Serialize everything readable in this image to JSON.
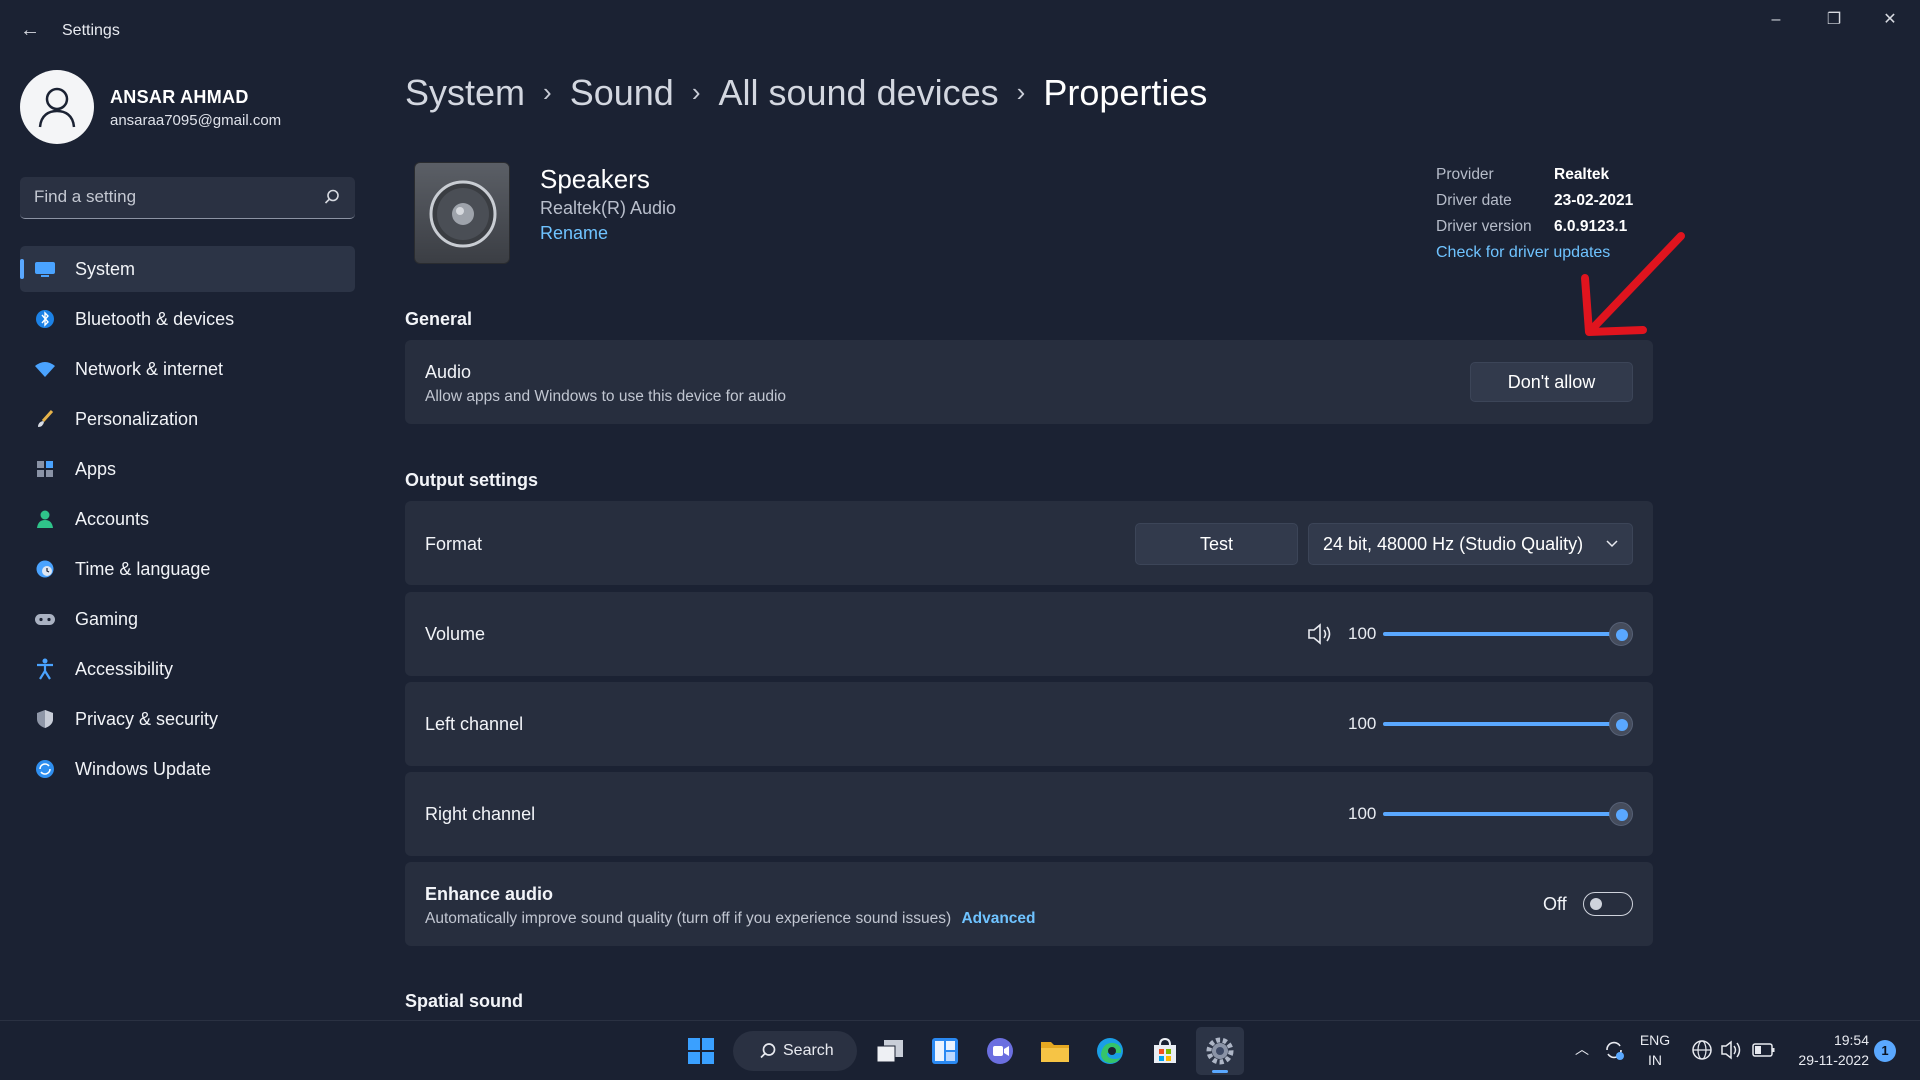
{
  "window": {
    "title": "Settings",
    "controls": [
      "minimize",
      "restore",
      "close"
    ]
  },
  "profile": {
    "name": "ANSAR AHMAD",
    "email": "ansaraa7095@gmail.com"
  },
  "search": {
    "placeholder": "Find a setting"
  },
  "sidebar": {
    "items": [
      {
        "label": "System",
        "icon": "monitor-icon",
        "active": true
      },
      {
        "label": "Bluetooth & devices",
        "icon": "bluetooth-icon"
      },
      {
        "label": "Network & internet",
        "icon": "wifi-icon"
      },
      {
        "label": "Personalization",
        "icon": "brush-icon"
      },
      {
        "label": "Apps",
        "icon": "apps-icon"
      },
      {
        "label": "Accounts",
        "icon": "person-icon"
      },
      {
        "label": "Time & language",
        "icon": "globe-clock-icon"
      },
      {
        "label": "Gaming",
        "icon": "gamepad-icon"
      },
      {
        "label": "Accessibility",
        "icon": "accessibility-icon"
      },
      {
        "label": "Privacy & security",
        "icon": "shield-icon"
      },
      {
        "label": "Windows Update",
        "icon": "update-icon"
      }
    ]
  },
  "breadcrumb": {
    "items": [
      "System",
      "Sound",
      "All sound devices"
    ],
    "current": "Properties",
    "separator": "›"
  },
  "device": {
    "name": "Speakers",
    "subtitle": "Realtek(R) Audio",
    "rename_link": "Rename"
  },
  "driver": {
    "provider_label": "Provider",
    "provider": "Realtek",
    "date_label": "Driver date",
    "date": "23-02-2021",
    "version_label": "Driver version",
    "version": "6.0.9123.1",
    "update_link": "Check for driver updates"
  },
  "general": {
    "section_title": "General",
    "audio_title": "Audio",
    "audio_desc": "Allow apps and Windows to use this device for audio",
    "audio_button": "Don't allow"
  },
  "output": {
    "section_title": "Output settings",
    "format_label": "Format",
    "test_button": "Test",
    "format_value": "24 bit, 48000 Hz (Studio Quality)",
    "volume_label": "Volume",
    "volume_value": "100",
    "left_label": "Left channel",
    "left_value": "100",
    "right_label": "Right channel",
    "right_value": "100",
    "enhance_title": "Enhance audio",
    "enhance_desc": "Automatically improve sound quality (turn off if you experience sound issues)",
    "enhance_link": "Advanced",
    "enhance_state": "Off"
  },
  "spatial": {
    "section_title": "Spatial sound"
  },
  "taskbar": {
    "search_label": "Search",
    "lang_top": "ENG",
    "lang_bottom": "IN",
    "time": "19:54",
    "date": "29-11-2022",
    "notifications": "1"
  },
  "colors": {
    "accent": "#5aa8ff",
    "link": "#6fc3ff",
    "background": "#1b2233",
    "card": "#272e3e",
    "annotation": "#e0141e"
  }
}
